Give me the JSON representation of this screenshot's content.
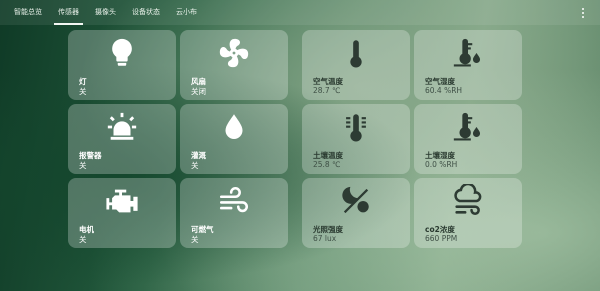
{
  "nav": {
    "tabs": [
      {
        "label": "智能总览"
      },
      {
        "label": "传感器"
      },
      {
        "label": "摄像头"
      },
      {
        "label": "设备状态"
      },
      {
        "label": "云小布"
      }
    ]
  },
  "devices": [
    {
      "name": "灯",
      "state": "关",
      "icon": "lightbulb-icon"
    },
    {
      "name": "风扇",
      "state": "关闭",
      "icon": "fan-icon"
    },
    {
      "name": "报警器",
      "state": "关",
      "icon": "alarm-light-icon"
    },
    {
      "name": "灌溉",
      "state": "关",
      "icon": "water-drop-icon"
    },
    {
      "name": "电机",
      "state": "关",
      "icon": "engine-icon"
    },
    {
      "name": "可燃气",
      "state": "关",
      "icon": "wind-icon"
    }
  ],
  "sensors": [
    {
      "name": "空气温度",
      "value": "28.7 ℃",
      "icon": "thermometer-icon"
    },
    {
      "name": "空气湿度",
      "value": "60.4 %RH",
      "icon": "humidity-icon"
    },
    {
      "name": "土壤温度",
      "value": "25.8 ℃",
      "icon": "soil-thermometer-icon"
    },
    {
      "name": "土壤湿度",
      "value": "0.0 %RH",
      "icon": "soil-humidity-icon"
    },
    {
      "name": "光照强度",
      "value": "67 lux",
      "icon": "day-night-icon"
    },
    {
      "name": "co2浓度",
      "value": "660 PPM",
      "icon": "cloud-wind-icon"
    }
  ],
  "colors": {
    "accent": "#f3f7f3",
    "card_bg": "rgba(255,255,255,0.26)",
    "dark_text": "#2a3a30"
  }
}
